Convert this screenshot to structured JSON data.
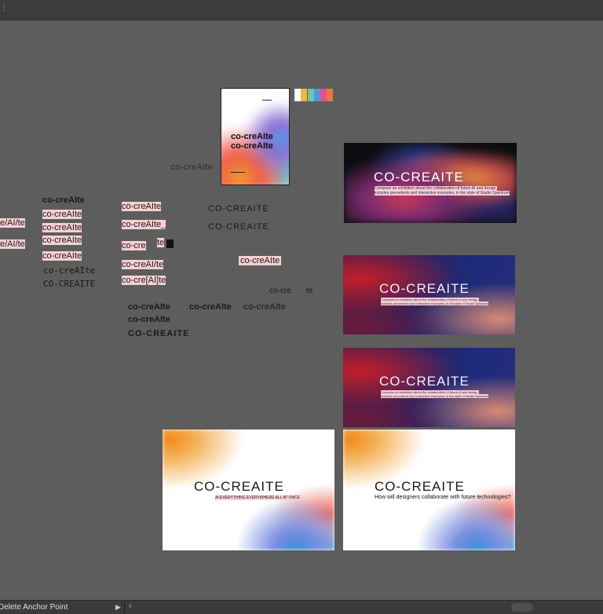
{
  "statusbar": {
    "tool_status": "Delete Anchor Point"
  },
  "swatches": [
    "#ffffff",
    "#f4b23e",
    "#6cc4b2",
    "#5b8fd6",
    "#e64f8f",
    "#e27b3a"
  ],
  "poster": {
    "line1": "co-creAIte",
    "line2": "co-creAIte"
  },
  "wordmark": "co-creAIte",
  "uppercase_mark": "CO-CREAITE",
  "variants": {
    "col_left_partial": [
      "e/AI/te",
      "e/AI/te"
    ],
    "col_a": [
      "co-creAIte",
      "co-creAIte",
      "co-creAIte",
      "co-creAIte",
      "co-creAIte",
      "co-creAIte",
      "CO-CREAITE"
    ],
    "col_b": [
      "co-creAIte",
      "co-creAIte_",
      "co-cre",
      "te",
      "co-creAI/te",
      "co-cre[AI]te"
    ],
    "caps": [
      "CO-CREAITE",
      "CO-CREAITE"
    ],
    "pink_single": "co-creAIte",
    "split_left": "co-cre",
    "split_right": "te",
    "bold_row": [
      "co-creAIte",
      "co-creAIte",
      "co-creAIte"
    ],
    "bold_stack": [
      "co-creAIte",
      "CO-CREAITE"
    ]
  },
  "banners": {
    "dark": {
      "title": "CO-CREAITE",
      "desc1": "Compose an exhibition about the collaboration of future AI and design,",
      "desc2": "includes precedents and interactive examples, in the style of Studio Spectrum"
    },
    "gradient1": {
      "title": "CO-CREAITE",
      "desc1": "Compose an exhibition about the collaboration of future AI and design,",
      "desc2": "includes precedents and interactive examples, in the style of Studio Spectrum"
    },
    "gradient2": {
      "title": "CO-CREAITE",
      "desc1": "Compose an exhibition about the collaboration of future AI and design,",
      "desc2": "includes precedents and interactive examples, in the style of Studio Spectrum"
    },
    "white1": {
      "title": "CO-CREAITE",
      "subtitle": "AI EVERYTHING EVERYWHERE ALL AT ONCE"
    },
    "white2": {
      "title": "CO-CREAITE",
      "subtitle": "How will designers collaborate with future technologies?"
    }
  }
}
